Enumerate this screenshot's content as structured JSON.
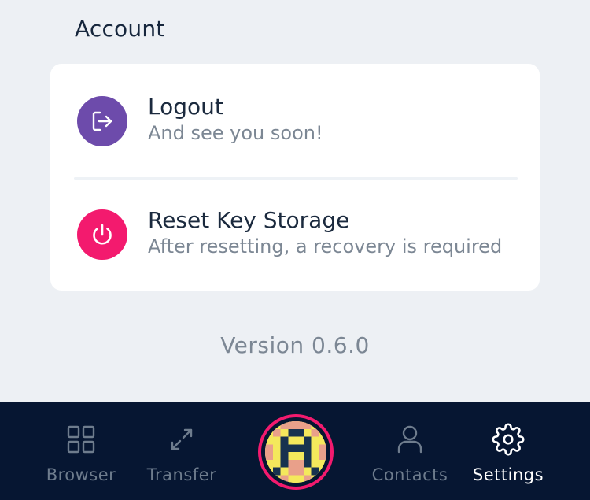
{
  "section": {
    "title": "Account"
  },
  "account_items": [
    {
      "title": "Logout",
      "subtitle": "And see you soon!",
      "icon": "logout-icon",
      "color": "#6d4bab"
    },
    {
      "title": "Reset Key Storage",
      "subtitle": "After resetting, a recovery is required",
      "icon": "power-icon",
      "color": "#f31a6e"
    }
  ],
  "version_text": "Version 0.6.0",
  "nav": {
    "items": [
      {
        "label": "Browser",
        "icon": "grid-icon",
        "active": false
      },
      {
        "label": "Transfer",
        "icon": "transfer-arrows-icon",
        "active": false
      },
      {
        "label": "Contacts",
        "icon": "person-icon",
        "active": false
      },
      {
        "label": "Settings",
        "icon": "gear-icon",
        "active": true
      }
    ],
    "center_avatar": {
      "icon": "identicon-avatar",
      "ring_color": "#f31a6e"
    }
  },
  "colors": {
    "background": "#edf0f4",
    "nav_background": "#061632",
    "muted_text": "#7c8794"
  }
}
